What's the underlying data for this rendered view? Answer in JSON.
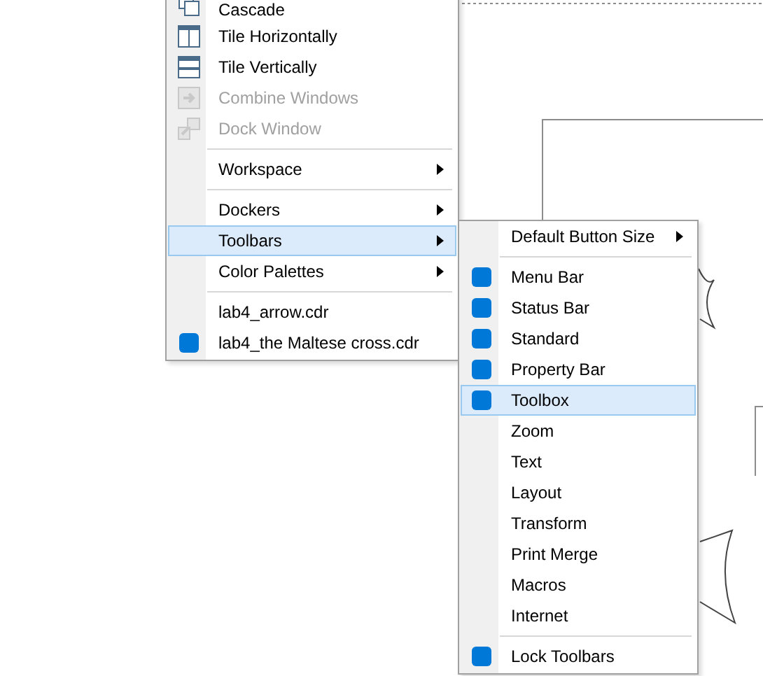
{
  "menu": {
    "items": [
      {
        "kind": "item",
        "label": "Cascade",
        "disabled": false,
        "checked": false,
        "selected": false,
        "submenu": false
      },
      {
        "kind": "item",
        "label": "Tile Horizontally",
        "disabled": false,
        "checked": false,
        "selected": false,
        "submenu": false
      },
      {
        "kind": "item",
        "label": "Tile Vertically",
        "disabled": false,
        "checked": false,
        "selected": false,
        "submenu": false
      },
      {
        "kind": "item",
        "label": "Combine Windows",
        "disabled": true,
        "checked": false,
        "selected": false,
        "submenu": false
      },
      {
        "kind": "item",
        "label": "Dock Window",
        "disabled": true,
        "checked": false,
        "selected": false,
        "submenu": false
      },
      {
        "kind": "separator"
      },
      {
        "kind": "item",
        "label": "Workspace",
        "disabled": false,
        "checked": false,
        "selected": false,
        "submenu": true
      },
      {
        "kind": "separator"
      },
      {
        "kind": "item",
        "label": "Dockers",
        "disabled": false,
        "checked": false,
        "selected": false,
        "submenu": true
      },
      {
        "kind": "item",
        "label": "Toolbars",
        "disabled": false,
        "checked": false,
        "selected": true,
        "submenu": true
      },
      {
        "kind": "item",
        "label": "Color Palettes",
        "disabled": false,
        "checked": false,
        "selected": false,
        "submenu": true
      },
      {
        "kind": "separator"
      },
      {
        "kind": "item",
        "label": "lab4_arrow.cdr",
        "disabled": false,
        "checked": false,
        "selected": false,
        "submenu": false
      },
      {
        "kind": "item",
        "label": "lab4_the Maltese cross.cdr",
        "disabled": false,
        "checked": true,
        "selected": false,
        "submenu": false
      }
    ]
  },
  "submenu": {
    "items": [
      {
        "kind": "item",
        "label": "Default Button Size",
        "disabled": false,
        "checked": false,
        "selected": false,
        "submenu": true
      },
      {
        "kind": "separator"
      },
      {
        "kind": "item",
        "label": "Menu Bar",
        "disabled": false,
        "checked": true,
        "selected": false,
        "submenu": false
      },
      {
        "kind": "item",
        "label": "Status Bar",
        "disabled": false,
        "checked": true,
        "selected": false,
        "submenu": false
      },
      {
        "kind": "item",
        "label": "Standard",
        "disabled": false,
        "checked": true,
        "selected": false,
        "submenu": false
      },
      {
        "kind": "item",
        "label": "Property Bar",
        "disabled": false,
        "checked": true,
        "selected": false,
        "submenu": false
      },
      {
        "kind": "item",
        "label": "Toolbox",
        "disabled": false,
        "checked": true,
        "selected": true,
        "submenu": false
      },
      {
        "kind": "item",
        "label": "Zoom",
        "disabled": false,
        "checked": false,
        "selected": false,
        "submenu": false
      },
      {
        "kind": "item",
        "label": "Text",
        "disabled": false,
        "checked": false,
        "selected": false,
        "submenu": false
      },
      {
        "kind": "item",
        "label": "Layout",
        "disabled": false,
        "checked": false,
        "selected": false,
        "submenu": false
      },
      {
        "kind": "item",
        "label": "Transform",
        "disabled": false,
        "checked": false,
        "selected": false,
        "submenu": false
      },
      {
        "kind": "item",
        "label": "Print Merge",
        "disabled": false,
        "checked": false,
        "selected": false,
        "submenu": false
      },
      {
        "kind": "item",
        "label": "Macros",
        "disabled": false,
        "checked": false,
        "selected": false,
        "submenu": false
      },
      {
        "kind": "item",
        "label": "Internet",
        "disabled": false,
        "checked": false,
        "selected": false,
        "submenu": false
      },
      {
        "kind": "separator"
      },
      {
        "kind": "item",
        "label": "Lock Toolbars",
        "disabled": false,
        "checked": true,
        "selected": false,
        "submenu": false
      }
    ]
  }
}
